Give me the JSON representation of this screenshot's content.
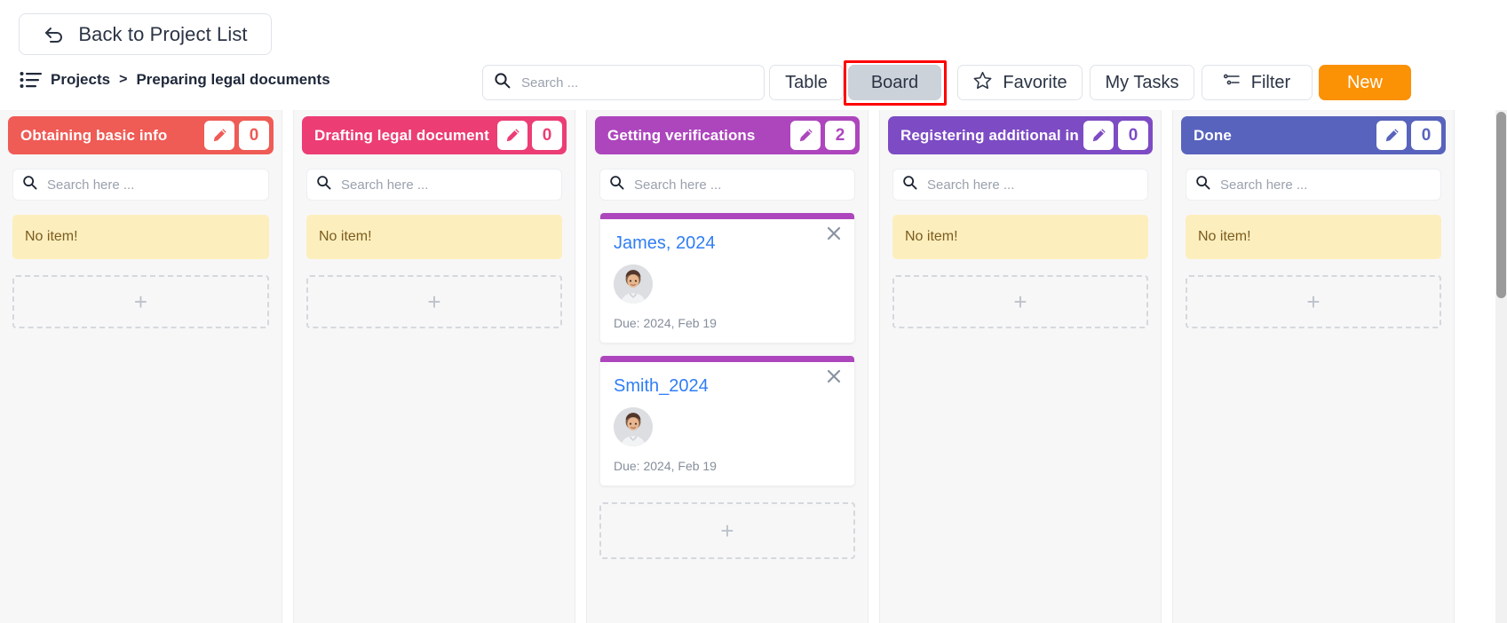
{
  "header": {
    "back_label": "Back to Project List",
    "breadcrumb_root": "Projects",
    "breadcrumb_separator": ">",
    "breadcrumb_current": "Preparing legal documents",
    "search_placeholder": "Search ...",
    "search_value": ""
  },
  "toolbar": {
    "table_label": "Table",
    "board_label": "Board",
    "favorite_label": "Favorite",
    "mytasks_label": "My Tasks",
    "filter_label": "Filter",
    "new_label": "New",
    "active_view": "Board",
    "highlight_color": "#ff0000",
    "new_button_color": "#fb9105",
    "active_button_color": "#ccd2d9"
  },
  "board": {
    "column_search_placeholder": "Search here ...",
    "empty_label": "No item!",
    "add_glyph": "+",
    "columns": [
      {
        "title": "Obtaining basic info",
        "color": "#ef5b55",
        "count": "0",
        "empty": true,
        "cards": []
      },
      {
        "title": "Drafting legal document",
        "color": "#ec3d75",
        "count": "0",
        "empty": true,
        "cards": []
      },
      {
        "title": "Getting verifications",
        "color": "#ad46bd",
        "count": "2",
        "empty": false,
        "cards": [
          {
            "title": "James, 2024",
            "due": "Due: 2024, Feb 19",
            "stripe": "#ad46bd"
          },
          {
            "title": "Smith_2024",
            "due": "Due: 2024, Feb 19",
            "stripe": "#ad46bd"
          }
        ]
      },
      {
        "title": "Registering additional info",
        "color": "#7d4bc4",
        "count": "0",
        "empty": true,
        "cards": []
      },
      {
        "title": "Done",
        "color": "#5863bd",
        "count": "0",
        "empty": true,
        "cards": []
      }
    ]
  }
}
